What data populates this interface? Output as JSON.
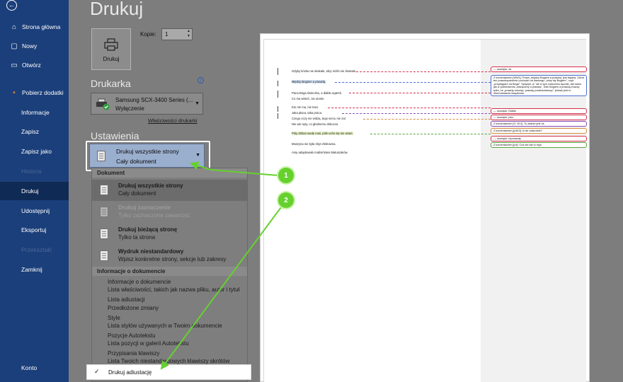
{
  "sidebar": {
    "items": [
      {
        "label": "Strona główna",
        "icon": "home-icon"
      },
      {
        "label": "Nowy",
        "icon": "new-document-icon"
      },
      {
        "label": "Otwórz",
        "icon": "folder-icon"
      },
      {
        "label": "Pobierz dodatki",
        "icon": "dot-icon"
      },
      {
        "label": "Informacje"
      },
      {
        "label": "Zapisz"
      },
      {
        "label": "Zapisz jako"
      },
      {
        "label": "Historia"
      },
      {
        "label": "Drukuj"
      },
      {
        "label": "Udostępnij"
      },
      {
        "label": "Eksportuj"
      },
      {
        "label": "Przekształć"
      },
      {
        "label": "Zamknij"
      },
      {
        "label": "Konto"
      }
    ]
  },
  "page": {
    "title": "Drukuj",
    "print_button": "Drukuj",
    "copies_label": "Kopie:",
    "copies_value": "1",
    "printer_heading": "Drukarka",
    "printer_name": "Samsung SCX-3400 Series (...",
    "printer_status": "Wyłączenie",
    "printer_props_link": "Właściwości drukarki",
    "settings_heading": "Ustawienia",
    "setting_main": "Drukuj wszystkie strony",
    "setting_sub": "Cały dokument"
  },
  "dropdown": {
    "section_document": "Dokument",
    "options": [
      {
        "title": "Drukuj wszystkie strony",
        "sub": "Cały dokument"
      },
      {
        "title": "Drukuj zaznaczenie",
        "sub": "Tylko zaznaczona zawartość"
      },
      {
        "title": "Drukuj bieżącą stronę",
        "sub": "Tylko ta strona"
      },
      {
        "title": "Wydruk niestandardowy",
        "sub": "Wpisz konkretne strony, sekcje lub zakresy"
      }
    ],
    "section_info": "Informacje o dokumencie",
    "info_items": [
      "Informacje o dokumencie",
      "Lista właściwości, takich jak nazwa pliku, autor i tytuł",
      "Lista adiustacji",
      "Przedłożone zmiany",
      "Style",
      "Lista stylów używanych w Twoim dokumencie",
      "Pozycje Autotekstu",
      "Lista pozycji w galerii Autotekstu",
      "Przypisania klawiszy",
      "Lista Twoich niestandardowych klawiszy skrótów"
    ],
    "adjust_item": "Drukuj adiustację",
    "adjust_check": "✓"
  },
  "badges": [
    "1",
    "2"
  ],
  "preview": {
    "lines": [
      "Gdyby kózka nie skakała, toby nóżki nie złamała.",
      "Między Bogiem a prawdą.",
      "Pana Boga świeczka, a diabłu ogarek.",
      "Co ma wisieć, nie utonie.",
      "Kto nie ma, nie traci.",
      "Jaka płaca, taka praca.",
      "Czego oczy nie widzą, tego sercu nie żal.",
      "Nie wie syty, co głodnemu dokucza.",
      "Póty dzban wodę nosi, póki ucho się nie urwie.",
      "Maszyna nie była zbyt efektowna.",
      "Anię adaptowało małżeństwo Matuszaków."
    ],
    "comments": [
      "— usunięto: ok",
      "Z komentarzem [WW1]: Fraza „między Bogiem a prawdą” jest błędna. Zwrot ten prawdopodobnie pochodzi od dawnego „żeby się Bogiem”, czyli „przysięgam na Boga”. Sprężyk „a” nie w tym znaczeniu łącznik, tak samo jak w powiedzeniu „wdzięczny a prawdą”. Dziś Bogiem a prawdą znaczy tylko, że „prawdę mówiąc, prawdę powiedziawszy”, jednak jest to sformułowanie książkowe.",
      "— usunięto: Diabłu",
      "— usunięto: piso",
      "Z komentarzem [O. W.2]: To zdanie jest ok.",
      "Z komentarzem [jc3K2]: A nie odwrotnie?",
      "— usunięto: toporawdy",
      "Z komentarzem [jc4]: Coś nie tak to myk."
    ]
  },
  "colors": {
    "sidebar": "#1b3f7a",
    "accent_green": "#66d12e",
    "selection": "#9aaece"
  }
}
